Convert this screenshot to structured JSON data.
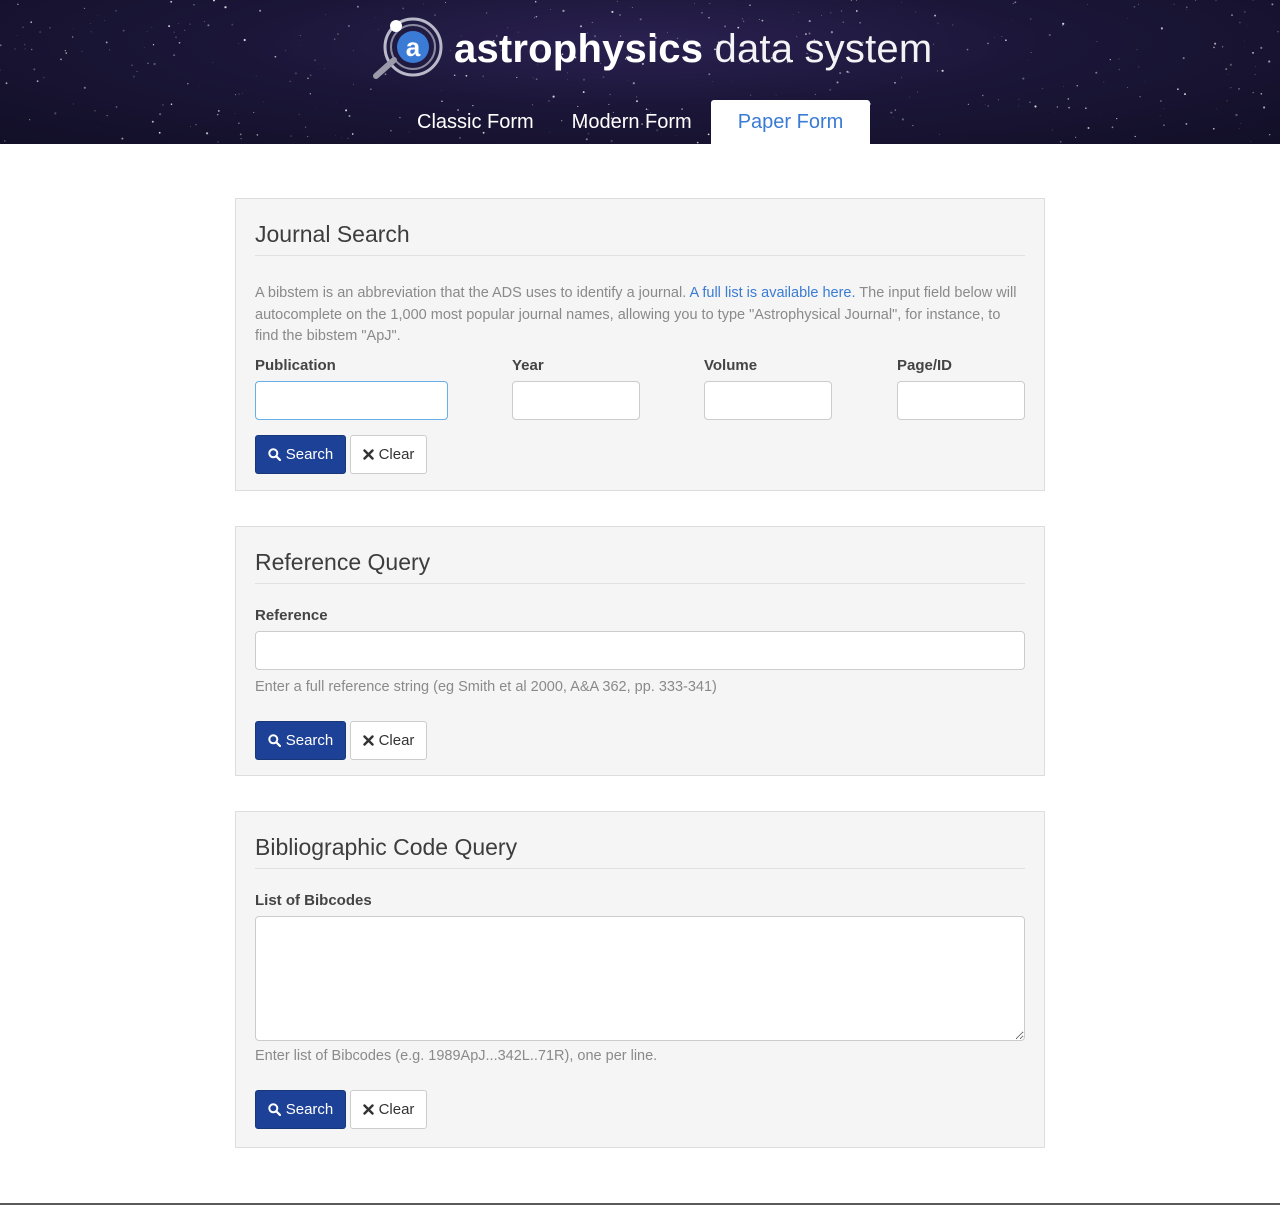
{
  "header": {
    "brand_bold": "astrophysics",
    "brand_light": "data system",
    "logo_letter": "a",
    "tabs": [
      {
        "label": "Classic Form",
        "active": false
      },
      {
        "label": "Modern Form",
        "active": false
      },
      {
        "label": "Paper Form",
        "active": true
      }
    ]
  },
  "journal": {
    "title": "Journal Search",
    "desc_before": "A bibstem is an abbreviation that the ADS uses to identify a journal. ",
    "desc_link": "A full list is available here.",
    "desc_after": " The input field below will autocomplete on the 1,000 most popular journal names, allowing you to type \"Astrophysical Journal\", for instance, to find the bibstem \"ApJ\".",
    "publication_label": "Publication",
    "year_label": "Year",
    "volume_label": "Volume",
    "page_label": "Page/ID",
    "publication_value": "",
    "year_value": "",
    "volume_value": "",
    "page_value": "",
    "search_label": "Search",
    "clear_label": "Clear"
  },
  "reference": {
    "title": "Reference Query",
    "field_label": "Reference",
    "value": "",
    "help": "Enter a full reference string (eg Smith et al 2000, A&A 362, pp. 333-341)",
    "search_label": "Search",
    "clear_label": "Clear"
  },
  "bibcode": {
    "title": "Bibliographic Code Query",
    "field_label": "List of Bibcodes",
    "value": "",
    "help": "Enter list of Bibcodes (e.g. 1989ApJ...342L..71R), one per line.",
    "search_label": "Search",
    "clear_label": "Clear"
  },
  "colors": {
    "primary_button": "#1c4196",
    "link": "#3a7bd5",
    "header_bg": "#1b1638",
    "panel_bg": "#f5f5f5"
  },
  "icons": {
    "search": "search-icon",
    "clear": "close-icon",
    "logo": "ads-logo-icon"
  }
}
